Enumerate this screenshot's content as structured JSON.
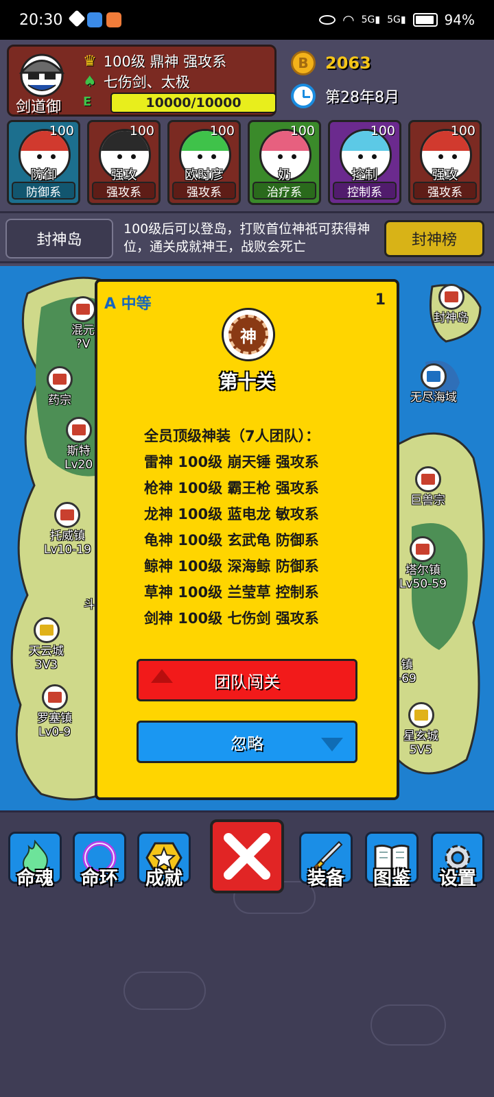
{
  "status_bar": {
    "time": "20:30",
    "network": "5G",
    "battery": "94%",
    "battery_level": 0.94
  },
  "profile": {
    "name": "剑道御",
    "rank_line": "100级 鼎神 强攻系",
    "skill_line": "七伤剑、太极",
    "exp_text": "10000/10000",
    "exp_fraction": 1.0
  },
  "resources": {
    "gold": "2063",
    "date": "第28年8月"
  },
  "team": [
    {
      "level": "100",
      "label": "防御",
      "type": "防御系",
      "bg": "#1c6f8e",
      "type_bg": "#12566f",
      "hair": "#d13a2e"
    },
    {
      "level": "100",
      "label": "强攻",
      "type": "强攻系",
      "bg": "#7b2a22",
      "type_bg": "#5e1d17",
      "hair": "#2a2a2a"
    },
    {
      "level": "100",
      "label": "欧时彦",
      "type": "强攻系",
      "bg": "#7b2a22",
      "type_bg": "#5e1d17",
      "hair": "#3fc24a"
    },
    {
      "level": "100",
      "label": "奶",
      "type": "治疗系",
      "bg": "#3a8a2a",
      "type_bg": "#2a6a1c",
      "hair": "#e7607f"
    },
    {
      "level": "100",
      "label": "控制",
      "type": "控制系",
      "bg": "#6b2a8e",
      "type_bg": "#511c6d",
      "hair": "#5cc9e6"
    },
    {
      "level": "100",
      "label": "强攻",
      "type": "强攻系",
      "bg": "#7b2a22",
      "type_bg": "#5e1d17",
      "hair": "#d13a2e"
    }
  ],
  "island": {
    "button": "封神岛",
    "description": "100级后可以登岛，打败首位神祇可获得神位，通关成就神王，战败会死亡",
    "rank_button": "封神榜"
  },
  "map_locations": [
    {
      "name": "封神岛",
      "sub": ""
    },
    {
      "name": "无尽海域",
      "sub": ""
    },
    {
      "name": "混元",
      "sub": "?V"
    },
    {
      "name": "药宗",
      "sub": ""
    },
    {
      "name": "斯特",
      "sub": "Lv20"
    },
    {
      "name": "巨兽宗",
      "sub": ""
    },
    {
      "name": "托威镇",
      "sub": "Lv10-19"
    },
    {
      "name": "塔尔镇",
      "sub": "Lv50-59"
    },
    {
      "name": "斗",
      "sub": ""
    },
    {
      "name": "天云城",
      "sub": "3V3"
    },
    {
      "name": "镇",
      "sub": "-69"
    },
    {
      "name": "罗塞镇",
      "sub": "Lv0-9"
    },
    {
      "name": "星玄城",
      "sub": "5V5"
    }
  ],
  "dialog": {
    "grade": "A 中等",
    "count": "1",
    "emblem": "神",
    "title": "第十关",
    "lines": [
      "全员顶级神装（7人团队）：",
      "雷神 100级 崩天锤 强攻系",
      "枪神 100级 霸王枪 强攻系",
      "龙神 100级 蓝电龙 敏攻系",
      "龟神 100级 玄武龟 防御系",
      "鲸神 100级 深海鲸 防御系",
      "草神 100级 兰莹草 控制系",
      "剑神 100级 七伤剑 强攻系"
    ],
    "challenge_button": "团队闯关",
    "ignore_button": "忽略"
  },
  "nav": {
    "soul": "命魂",
    "ring": "命环",
    "achievement": "成就",
    "equipment": "装备",
    "codex": "图鉴",
    "settings": "设置"
  }
}
